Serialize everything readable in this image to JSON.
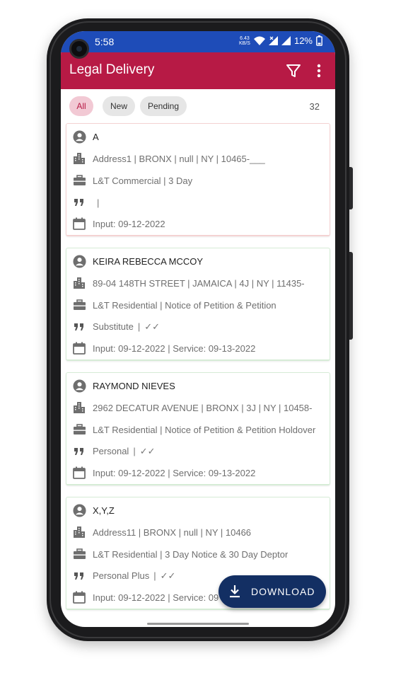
{
  "status_bar": {
    "time": "5:58",
    "speed_top": "6.43",
    "speed_bottom": "KB/S",
    "battery": "12%"
  },
  "app_bar": {
    "title": "Legal Delivery",
    "icons": [
      "filter-icon",
      "more-vert-icon"
    ]
  },
  "filters": {
    "chips": [
      {
        "label": "All",
        "active": true
      },
      {
        "label": "New",
        "active": false
      },
      {
        "label": "Pending",
        "active": false
      }
    ],
    "count": "32"
  },
  "cards": [
    {
      "name": "A",
      "address": "Address1 | BRONX | null | NY | 10465-___",
      "case_type": "L&T Commercial | 3 Day",
      "service_type": "",
      "service_checks": "",
      "dates": "Input: 09-12-2022",
      "status_color": "#f1b8b8"
    },
    {
      "name": "KEIRA REBECCA MCCOY",
      "address": "89-04 148TH STREET | JAMAICA | 4J | NY | 11435-",
      "case_type": "L&T Residential | Notice of Petition & Petition",
      "service_type": "Substitute",
      "service_checks": "✓✓",
      "dates": "Input: 09-12-2022 | Service: 09-13-2022",
      "status_color": "#bfe2bf"
    },
    {
      "name": "RAYMOND NIEVES",
      "address": "2962 DECATUR AVENUE | BRONX | 3J | NY | 10458-",
      "case_type": "L&T Residential | Notice of Petition & Petition Holdover",
      "service_type": "Personal",
      "service_checks": "✓✓",
      "dates": "Input: 09-12-2022 | Service: 09-13-2022",
      "status_color": "#bfe2bf"
    },
    {
      "name": "X,Y,Z",
      "address": "Address11 | BRONX | null | NY | 10466",
      "case_type": "L&T Residential | 3 Day Notice & 30 Day Deptor",
      "service_type": "Personal Plus",
      "service_checks": "✓✓",
      "dates": "Input: 09-12-2022 | Service: 09",
      "status_color": "#bfe2bf"
    }
  ],
  "fab": {
    "label": "DOWNLOAD",
    "icon": "download-icon"
  },
  "colors": {
    "status_bar": "#1e4cb8",
    "app_bar": "#b71a45",
    "chip_active": "#f2c9d4",
    "fab": "#132f63"
  }
}
